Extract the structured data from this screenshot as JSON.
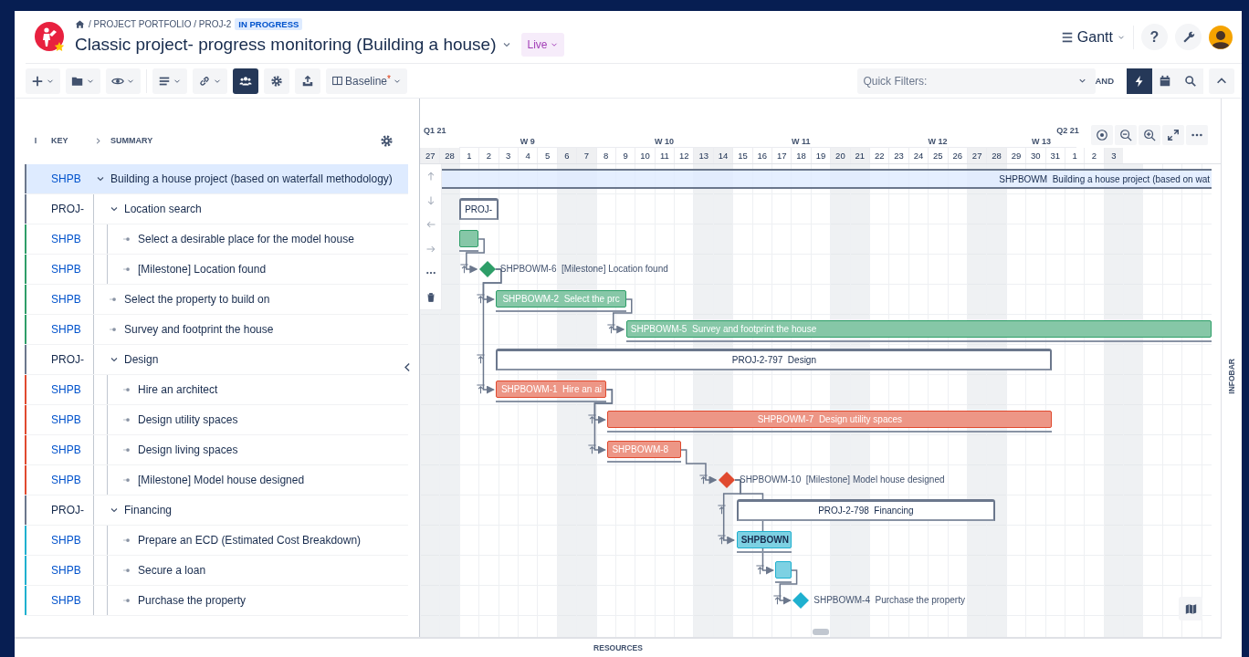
{
  "header": {
    "breadcrumb": [
      "/ PROJECT PORTFOLIO / PROJ-2"
    ],
    "status": "IN PROGRESS",
    "title": "Classic project- progress monitoring (Building a house)",
    "mode": "Live",
    "view": "Gantt",
    "help": "?"
  },
  "toolbar": {
    "buttons": [
      {
        "kind": "menu",
        "selected": false
      },
      {
        "kind": "menu",
        "selected": false
      },
      {
        "kind": "menu",
        "selected": false
      },
      {
        "kind": "menu",
        "selected": false
      },
      {
        "kind": "menu",
        "selected": false
      },
      {
        "kind": "icon",
        "selected": true
      },
      {
        "kind": "icon",
        "selected": false
      },
      {
        "kind": "icon",
        "selected": false
      }
    ],
    "baseline": {
      "label": "Baseline",
      "marker": "*"
    },
    "quick_filters": {
      "placeholder": "Quick Filters:",
      "operator": "AND"
    },
    "tools": [
      {
        "selected": true
      },
      {
        "selected": false
      },
      {
        "selected": false
      }
    ]
  },
  "columns": {
    "key": "KEY",
    "summary": "SUMMARY"
  },
  "rows": [
    {
      "key": "SHPB",
      "summary": "Building a house project (based on waterfall methodology)",
      "kind": "issue",
      "color": "#6b778c",
      "selected": true,
      "expanded": true,
      "bar": {
        "kind": "summary",
        "label": "SHPBOWM  Building a house project (based on wat"
      },
      "children": [
        {
          "key": "PROJ-",
          "summary": "Location search",
          "kind": "group",
          "color": "#6b778c",
          "selected": false,
          "expanded": true,
          "bar": {
            "kind": "group",
            "label": "PROJ-"
          },
          "children": [
            {
              "key": "SHPB",
              "summary": "Select a desirable place for the model house",
              "kind": "issue",
              "color": "#2e9e68",
              "selected": false,
              "bar": {
                "kind": "task"
              }
            },
            {
              "key": "SHPB",
              "summary": "[Milestone] Location found",
              "kind": "issue",
              "color": "#2e9e68",
              "selected": false,
              "bar": {
                "kind": "milestone",
                "label": "SHPBOWM-6  [Milestone] Location found"
              }
            }
          ]
        },
        {
          "key": "SHPB",
          "summary": "Select the property to build on",
          "kind": "issue",
          "color": "#2e9e68",
          "selected": false,
          "bar": {
            "kind": "task",
            "label": "SHPBOWM-2  Select the prc"
          }
        },
        {
          "key": "SHPB",
          "summary": "Survey and footprint the house",
          "kind": "issue",
          "color": "#2e9e68",
          "selected": false,
          "bar": {
            "kind": "task",
            "label": "SHPBOWM-5  Survey and footprint the house"
          }
        },
        {
          "key": "PROJ-",
          "summary": "Design",
          "kind": "group",
          "color": "#6b778c",
          "selected": false,
          "expanded": true,
          "bar": {
            "kind": "group",
            "label": "PROJ-2-797  Design"
          },
          "children": [
            {
              "key": "SHPB",
              "summary": "Hire an architect",
              "kind": "issue",
              "color": "#e04a2f",
              "selected": false,
              "bar": {
                "kind": "task",
                "label": "SHPBOWM-1  Hire an ai"
              }
            },
            {
              "key": "SHPB",
              "summary": "Design utility spaces",
              "kind": "issue",
              "color": "#e04a2f",
              "selected": false,
              "bar": {
                "kind": "task",
                "label": "SHPBOWM-7  Design utility spaces"
              }
            },
            {
              "key": "SHPB",
              "summary": "Design living spaces",
              "kind": "issue",
              "color": "#e04a2f",
              "selected": false,
              "bar": {
                "kind": "task",
                "label": "SHPBOWM-8"
              }
            },
            {
              "key": "SHPB",
              "summary": "[Milestone] Model house designed",
              "kind": "issue",
              "color": "#e04a2f",
              "selected": false,
              "bar": {
                "kind": "milestone",
                "label": "SHPBOWM-10  [Milestone] Model house designed"
              }
            }
          ]
        },
        {
          "key": "PROJ-",
          "summary": "Financing",
          "kind": "group",
          "color": "#6b778c",
          "selected": false,
          "expanded": true,
          "bar": {
            "kind": "group",
            "label": "PROJ-2-798  Financing"
          },
          "children": [
            {
              "key": "SHPB",
              "summary": "Prepare an ECD (Estimated Cost Breakdown)",
              "kind": "issue",
              "color": "#1fb0cf",
              "selected": false,
              "bar": {
                "kind": "task",
                "label": "SHPBOWN"
              }
            },
            {
              "key": "SHPB",
              "summary": "Secure a loan",
              "kind": "issue",
              "color": "#1fb0cf",
              "selected": false,
              "bar": {
                "kind": "task"
              }
            },
            {
              "key": "SHPB",
              "summary": "Purchase the property",
              "kind": "issue",
              "color": "#1fb0cf",
              "selected": false,
              "bar": {
                "kind": "milestone",
                "label": "SHPBOWM-4  Purchase the property"
              }
            }
          ]
        }
      ]
    }
  ],
  "timeline": {
    "quarters": [
      "Q1 21",
      "Q2 21"
    ],
    "weeks": [
      "W 9",
      "W 10",
      "W 11",
      "W 12",
      "W 13"
    ],
    "days": [
      {
        "label": "27",
        "weekend": true
      },
      {
        "label": "28",
        "weekend": true
      },
      {
        "label": "1",
        "weekend": false
      },
      {
        "label": "2",
        "weekend": false
      },
      {
        "label": "3",
        "weekend": false
      },
      {
        "label": "4",
        "weekend": false
      },
      {
        "label": "5",
        "weekend": false
      },
      {
        "label": "6",
        "weekend": true
      },
      {
        "label": "7",
        "weekend": true
      },
      {
        "label": "8",
        "weekend": false
      },
      {
        "label": "9",
        "weekend": false
      },
      {
        "label": "10",
        "weekend": false
      },
      {
        "label": "11",
        "weekend": false
      },
      {
        "label": "12",
        "weekend": false
      },
      {
        "label": "13",
        "weekend": true
      },
      {
        "label": "14",
        "weekend": true
      },
      {
        "label": "15",
        "weekend": false
      },
      {
        "label": "16",
        "weekend": false
      },
      {
        "label": "17",
        "weekend": false
      },
      {
        "label": "18",
        "weekend": false
      },
      {
        "label": "19",
        "weekend": false
      },
      {
        "label": "20",
        "weekend": true
      },
      {
        "label": "21",
        "weekend": true
      },
      {
        "label": "22",
        "weekend": false
      },
      {
        "label": "23",
        "weekend": false
      },
      {
        "label": "24",
        "weekend": false
      },
      {
        "label": "25",
        "weekend": false
      },
      {
        "label": "26",
        "weekend": false
      },
      {
        "label": "27",
        "weekend": true
      },
      {
        "label": "28",
        "weekend": true
      },
      {
        "label": "29",
        "weekend": false
      },
      {
        "label": "30",
        "weekend": false
      },
      {
        "label": "31",
        "weekend": false
      },
      {
        "label": "1",
        "weekend": false
      },
      {
        "label": "2",
        "weekend": false
      },
      {
        "label": "3",
        "weekend": true
      }
    ]
  },
  "panels": {
    "infobar": "INFOBAR",
    "resources": "RESOURCES"
  }
}
